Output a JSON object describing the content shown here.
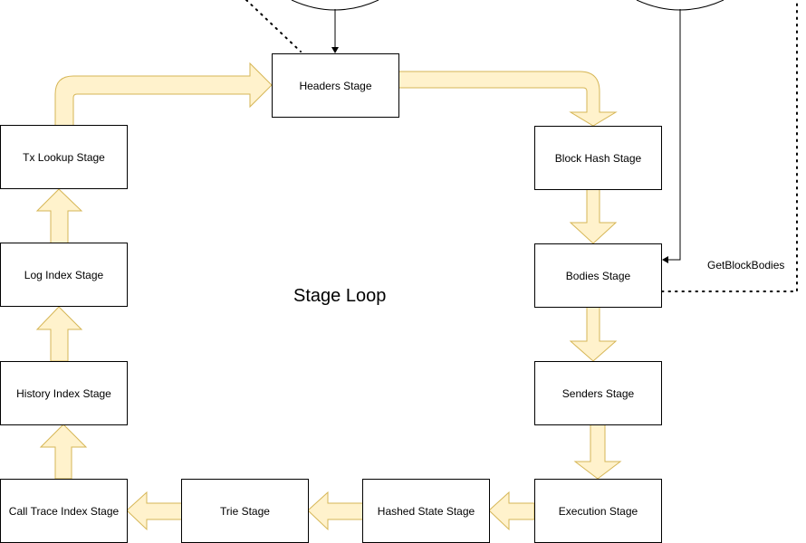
{
  "diagram": {
    "title": "Stage Loop",
    "colors": {
      "arrow_fill": "#FFF2CC",
      "arrow_stroke": "#D6B656",
      "box_stroke": "#000000",
      "connector": "#000000"
    },
    "stages": [
      {
        "id": "headers",
        "label": "Headers Stage"
      },
      {
        "id": "block_hash",
        "label": "Block Hash Stage"
      },
      {
        "id": "bodies",
        "label": "Bodies Stage"
      },
      {
        "id": "senders",
        "label": "Senders Stage"
      },
      {
        "id": "execution",
        "label": "Execution Stage"
      },
      {
        "id": "hashed_state",
        "label": "Hashed State Stage"
      },
      {
        "id": "trie",
        "label": "Trie Stage"
      },
      {
        "id": "call_trace_index",
        "label": "Call Trace Index Stage"
      },
      {
        "id": "history_index",
        "label": "History Index Stage"
      },
      {
        "id": "log_index",
        "label": "Log Index Stage"
      },
      {
        "id": "tx_lookup",
        "label": "Tx Lookup Stage"
      }
    ],
    "flow": [
      {
        "from": "headers",
        "to": "block_hash"
      },
      {
        "from": "block_hash",
        "to": "bodies"
      },
      {
        "from": "bodies",
        "to": "senders"
      },
      {
        "from": "senders",
        "to": "execution"
      },
      {
        "from": "execution",
        "to": "hashed_state"
      },
      {
        "from": "hashed_state",
        "to": "trie"
      },
      {
        "from": "trie",
        "to": "call_trace_index"
      },
      {
        "from": "call_trace_index",
        "to": "history_index"
      },
      {
        "from": "history_index",
        "to": "log_index"
      },
      {
        "from": "log_index",
        "to": "tx_lookup"
      },
      {
        "from": "tx_lookup",
        "to": "headers"
      }
    ],
    "connectors": [
      {
        "name": "headers-input",
        "to": "headers",
        "style": "solid",
        "label": ""
      },
      {
        "name": "bodies-input",
        "to": "bodies",
        "style": "solid",
        "label": ""
      },
      {
        "name": "get-block-bodies",
        "from": "bodies",
        "style": "dotted",
        "label": "GetBlockBodies"
      },
      {
        "name": "headers-dotted",
        "from": "headers",
        "style": "dotted",
        "label": ""
      }
    ]
  }
}
